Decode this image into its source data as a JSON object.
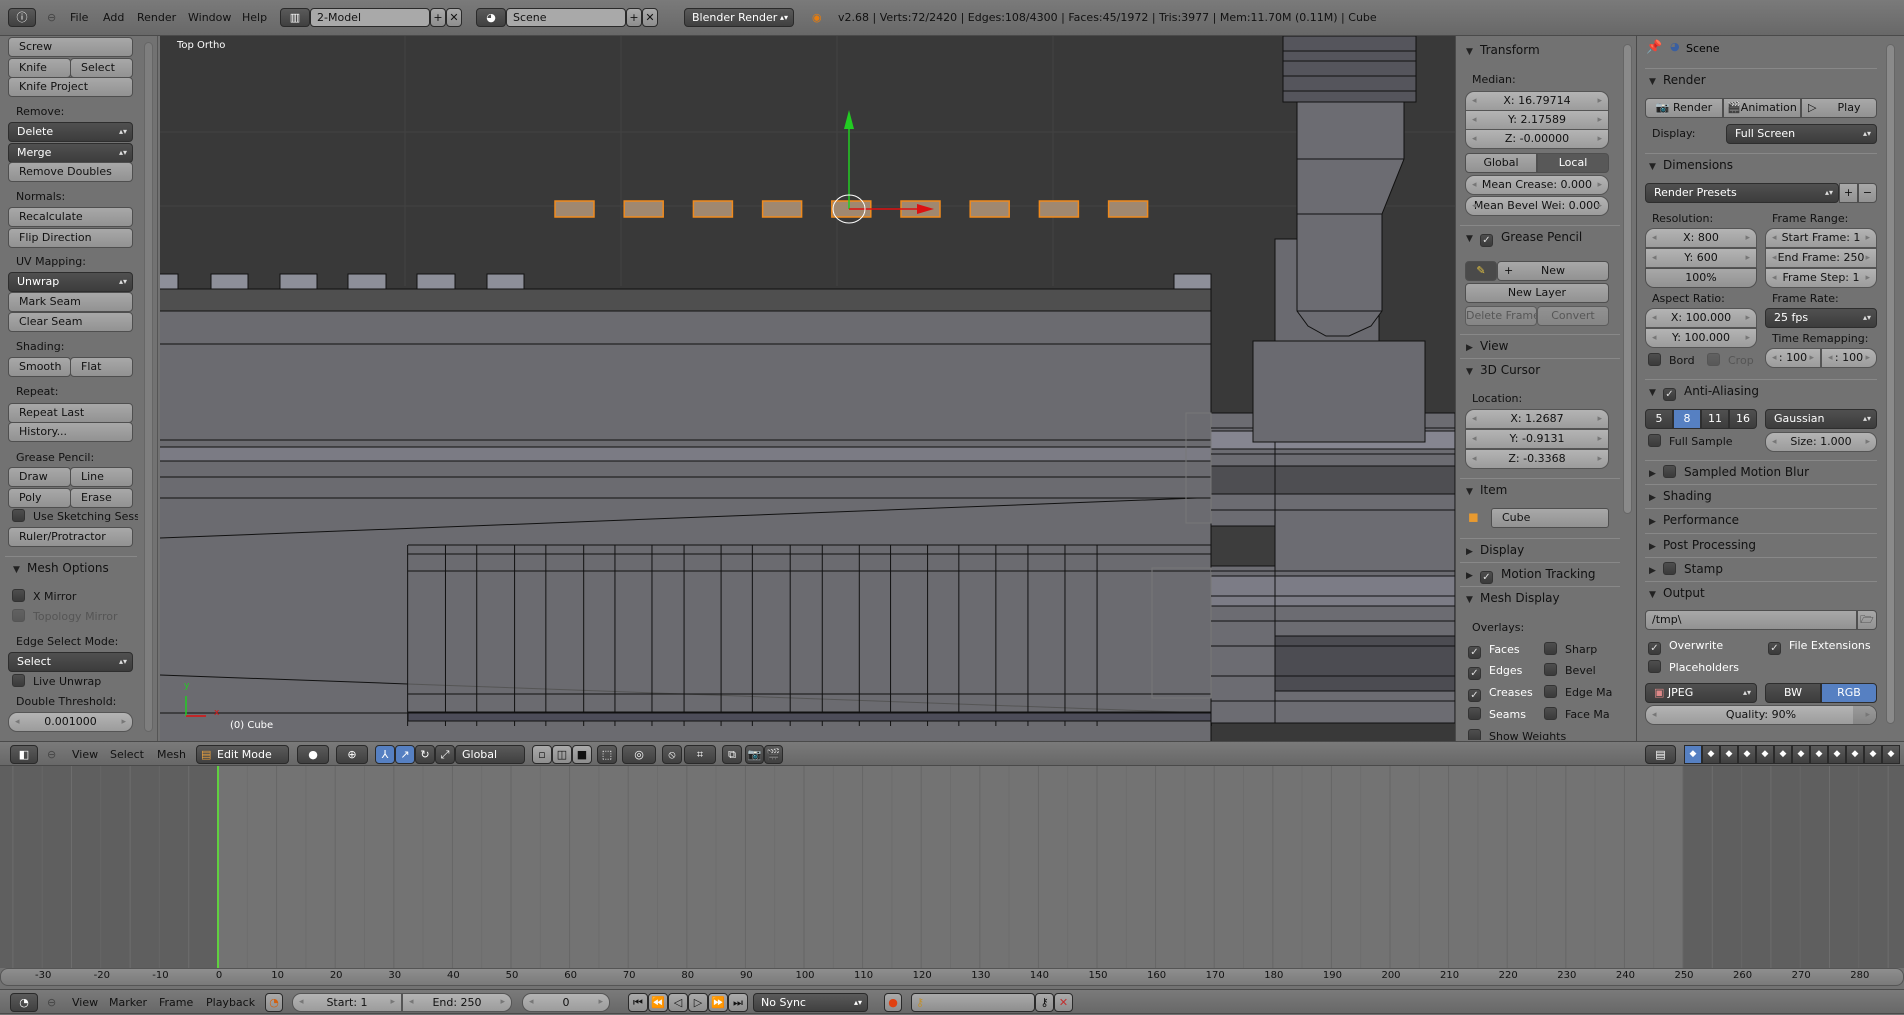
{
  "topbar": {
    "menus": [
      "File",
      "Add",
      "Render",
      "Window",
      "Help"
    ],
    "screen_layout": "2-Model",
    "scene": "Scene",
    "render_engine": "Blender Render",
    "stats": "v2.68 | Verts:72/2420 | Edges:108/4300 | Faces:45/1972 | Tris:3977 | Mem:11.70M (0.11M) | Cube"
  },
  "toolbar": {
    "screw": "Screw",
    "knife": "Knife",
    "select": "Select",
    "knife_project": "Knife Project",
    "remove_label": "Remove:",
    "delete": "Delete",
    "merge": "Merge",
    "remove_doubles": "Remove Doubles",
    "normals_label": "Normals:",
    "recalculate": "Recalculate",
    "flip_direction": "Flip Direction",
    "uv_label": "UV Mapping:",
    "unwrap": "Unwrap",
    "mark_seam": "Mark Seam",
    "clear_seam": "Clear Seam",
    "shading_label": "Shading:",
    "smooth": "Smooth",
    "flat": "Flat",
    "repeat_label": "Repeat:",
    "repeat_last": "Repeat Last",
    "history": "History...",
    "gp_label": "Grease Pencil:",
    "draw": "Draw",
    "line": "Line",
    "poly": "Poly",
    "erase": "Erase",
    "use_sketching": "Use Sketching Sessi",
    "ruler": "Ruler/Protractor",
    "mesh_options": "Mesh Options",
    "x_mirror": "X Mirror",
    "topology_mirror": "Topology Mirror",
    "edge_select_label": "Edge Select Mode:",
    "edge_select_value": "Select",
    "live_unwrap": "Live Unwrap",
    "double_threshold_label": "Double Threshold:",
    "double_threshold": "0.001000"
  },
  "viewport": {
    "view_name": "Top Ortho",
    "object_label": "(0) Cube",
    "axis_x": "x",
    "axis_y": "y",
    "accent_selected": "#f08a1d",
    "background": "#393939"
  },
  "npanel": {
    "transform": "Transform",
    "median": "Median:",
    "x": "X: 16.79714",
    "y": "Y: 2.17589",
    "z": "Z: -0.00000",
    "global": "Global",
    "local": "Local",
    "mean_crease": "Mean Crease: 0.000",
    "mean_bevel": "Mean Bevel Wei: 0.000",
    "grease_pencil": "Grease Pencil",
    "new": "New",
    "new_layer": "New Layer",
    "delete_frame": "Delete Frame",
    "convert": "Convert",
    "view": "View",
    "cursor": "3D Cursor",
    "location": "Location:",
    "cx": "X: 1.2687",
    "cy": "Y: -0.9131",
    "cz": "Z: -0.3368",
    "item": "Item",
    "item_name": "Cube",
    "display": "Display",
    "motion_tracking": "Motion Tracking",
    "mesh_display": "Mesh Display",
    "overlays": "Overlays:",
    "faces": "Faces",
    "sharp": "Sharp",
    "edges": "Edges",
    "bevel": "Bevel",
    "creases": "Creases",
    "edge_ma": "Edge Ma",
    "seams": "Seams",
    "face_ma": "Face Ma",
    "show_weights": "Show Weights"
  },
  "properties": {
    "context": "Scene",
    "render": "Render",
    "render_btn": "Render",
    "animation_btn": "Animation",
    "play_btn": "Play",
    "display_label": "Display:",
    "display_value": "Full Screen",
    "dimensions": "Dimensions",
    "render_presets": "Render Presets",
    "resolution": "Resolution:",
    "res_x": "X: 800",
    "res_y": "Y: 600",
    "res_pct": "100%",
    "frame_range": "Frame Range:",
    "start_frame": "Start Frame: 1",
    "end_frame": "End Frame: 250",
    "frame_step": "Frame Step: 1",
    "aspect_ratio": "Aspect Ratio:",
    "asp_x": "X: 100.000",
    "asp_y": "Y: 100.000",
    "frame_rate": "Frame Rate:",
    "fps": "25 fps",
    "time_remapping": "Time Remapping:",
    "remap_old": ": 100",
    "remap_new": ": 100",
    "bord": "Bord",
    "crop": "Crop",
    "anti_aliasing": "Anti-Aliasing",
    "aa_samples": [
      "5",
      "8",
      "11",
      "16"
    ],
    "aa_selected": "8",
    "aa_filter": "Gaussian",
    "full_sample": "Full Sample",
    "size": "Size: 1.000",
    "sampled_motion_blur": "Sampled Motion Blur",
    "shading": "Shading",
    "performance": "Performance",
    "post_processing": "Post Processing",
    "stamp": "Stamp",
    "output": "Output",
    "output_path": "/tmp\\",
    "overwrite": "Overwrite",
    "file_extensions": "File Extensions",
    "placeholders": "Placeholders",
    "format": "JPEG",
    "bw": "BW",
    "rgb": "RGB",
    "quality": "Quality: 90%",
    "quality_value": 90,
    "accent": "#5680c2"
  },
  "view3d_header": {
    "view": "View",
    "select": "Select",
    "mesh": "Mesh",
    "mode": "Edit Mode",
    "orientation": "Global"
  },
  "timeline": {
    "ruler_ticks": [
      -30,
      -20,
      -10,
      0,
      10,
      20,
      30,
      40,
      50,
      60,
      70,
      80,
      90,
      100,
      110,
      120,
      130,
      140,
      150,
      160,
      170,
      180,
      190,
      200,
      210,
      220,
      230,
      240,
      250,
      260,
      270,
      280
    ],
    "current_frame": 0,
    "start": 1,
    "end": 250,
    "view": "View",
    "marker": "Marker",
    "frame": "Frame",
    "playback": "Playback",
    "start_label": "Start: 1",
    "end_label": "End: 250",
    "frame_value": "0",
    "sync": "No Sync",
    "playhead_color": "#60d040"
  }
}
